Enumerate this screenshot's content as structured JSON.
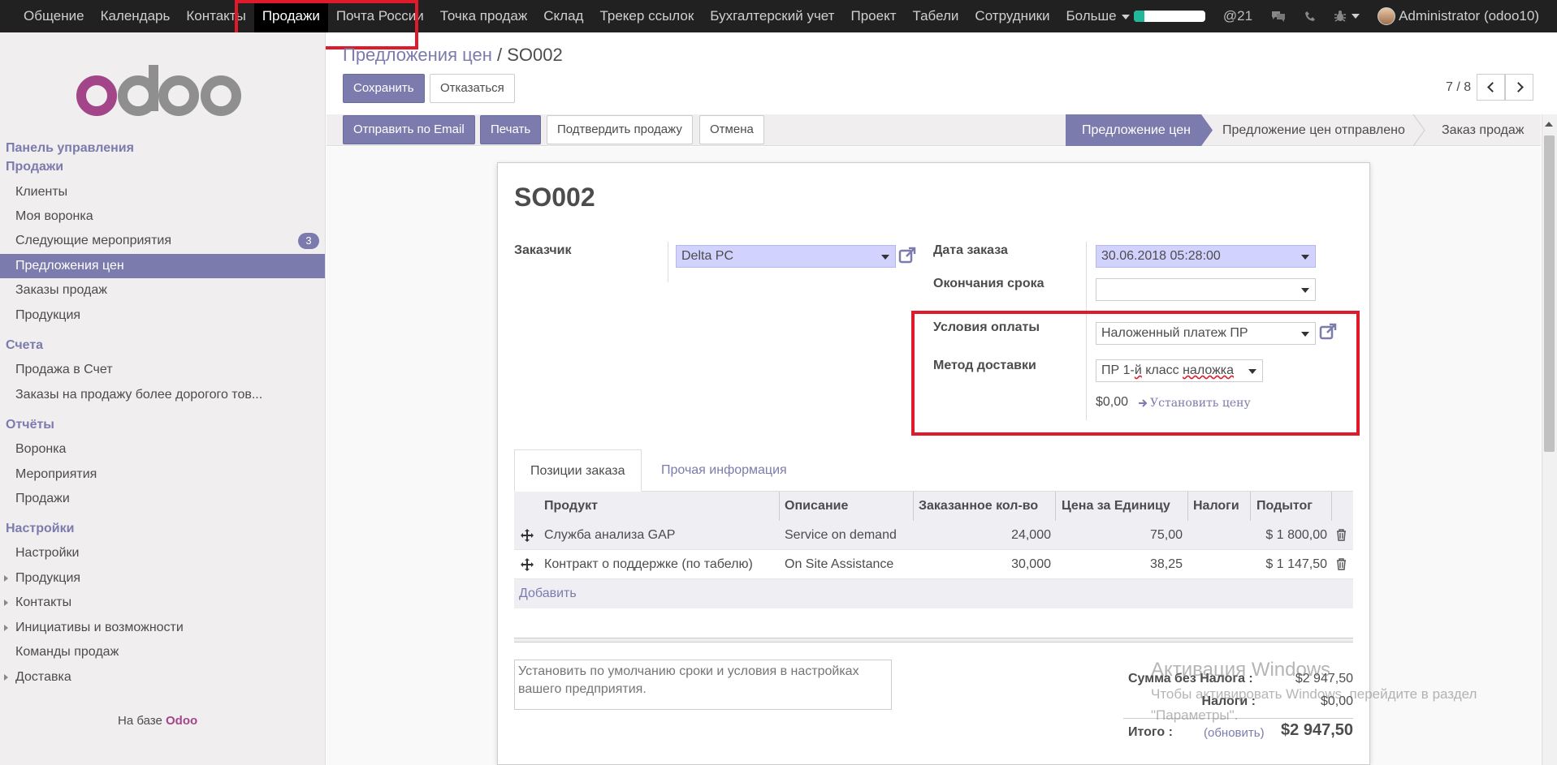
{
  "topnav": {
    "items": [
      "Общение",
      "Календарь",
      "Контакты",
      "Продажи",
      "Почта России",
      "Точка продаж",
      "Склад",
      "Трекер ссылок",
      "Бухгалтерский учет",
      "Проект",
      "Табели",
      "Сотрудники",
      "Больше"
    ],
    "active": "Продажи",
    "mentions_count": "@21",
    "user": "Administrator (odoo10)",
    "progress_fraction": 0.15,
    "progress_color": "#21b799"
  },
  "sidebar": {
    "logo": "odoo",
    "sections": [
      {
        "title": "Панель управления"
      },
      {
        "title": "Продажи",
        "items": [
          {
            "label": "Клиенты"
          },
          {
            "label": "Моя воронка"
          },
          {
            "label": "Следующие мероприятия",
            "badge": "3"
          },
          {
            "label": "Предложения цен",
            "active": true
          },
          {
            "label": "Заказы продаж"
          },
          {
            "label": "Продукция"
          }
        ]
      },
      {
        "title": "Счета",
        "items": [
          {
            "label": "Продажа в Счет"
          },
          {
            "label": "Заказы на продажу более дорогого тов..."
          }
        ]
      },
      {
        "title": "Отчёты",
        "items": [
          {
            "label": "Воронка"
          },
          {
            "label": "Мероприятия"
          },
          {
            "label": "Продажи"
          }
        ]
      },
      {
        "title": "Настройки",
        "items": [
          {
            "label": "Настройки"
          },
          {
            "label": "Продукция",
            "expandable": true
          },
          {
            "label": "Контакты",
            "expandable": true
          },
          {
            "label": "Инициативы и возможности",
            "expandable": true
          },
          {
            "label": "Команды продаж"
          },
          {
            "label": "Доставка",
            "expandable": true
          }
        ]
      }
    ],
    "powered_prefix": "На базе",
    "powered_brand": "Odoo"
  },
  "breadcrumb": {
    "parent": "Предложения цен",
    "sep": "/",
    "current": "SO002"
  },
  "toolbar": {
    "save": "Сохранить",
    "discard": "Отказаться"
  },
  "pager": {
    "value": "7 / 8"
  },
  "actions": {
    "email": "Отправить по Email",
    "print": "Печать",
    "confirm": "Подтвердить продажу",
    "cancel": "Отмена"
  },
  "stages": [
    "Предложение цен",
    "Предложение цен отправлено",
    "Заказ продаж"
  ],
  "active_stage": "Предложение цен",
  "form": {
    "title": "SO002",
    "customer_label": "Заказчик",
    "customer_value": "Delta PC",
    "order_date_label": "Дата заказа",
    "order_date_value": "30.06.2018 05:28:00",
    "validity_label": "Окончания срока",
    "validity_value": "",
    "payment_terms_label": "Условия оплаты",
    "payment_terms_value": "Наложенный платеж ПР",
    "delivery_label": "Метод доставки",
    "delivery_value_pre": "ПР 1-",
    "delivery_value_err1": "й",
    "delivery_value_mid": " класс ",
    "delivery_value_err2": "наложка",
    "delivery_price": "$0,00",
    "set_price": "Установить цену"
  },
  "tabs": [
    "Позиции заказа",
    "Прочая информация"
  ],
  "table": {
    "headers": [
      "Продукт",
      "Описание",
      "Заказанное кол-во",
      "Цена за Единицу",
      "Налоги",
      "Подытог"
    ],
    "rows": [
      {
        "product": "Служба анализа GAP",
        "description": "Service on demand",
        "qty": "24,000",
        "price": "75,00",
        "taxes": "",
        "subtotal": "$ 1 800,00"
      },
      {
        "product": "Контракт о поддержке (по табелю)",
        "description": "On Site Assistance",
        "qty": "30,000",
        "price": "38,25",
        "taxes": "",
        "subtotal": "$ 1 147,50"
      }
    ],
    "add_line": "Добавить"
  },
  "note_placeholder": "Установить по умолчанию сроки и условия в настройках вашего предприятия.",
  "totals": {
    "untaxed_label": "Сумма без Налога :",
    "untaxed_value": "$2 947,50",
    "taxes_label": "Налоги :",
    "taxes_value": "$0,00",
    "total_label": "Итого :",
    "update_label": "(обновить)",
    "total_value": "$2 947,50"
  },
  "watermark": {
    "line1": "Активация Windows",
    "line2": "Чтобы активировать Windows, перейдите в раздел",
    "line3": "\"Параметры\"."
  },
  "colors": {
    "accent": "#7c7bad",
    "topbar": "#212121",
    "highlight_box": "#e01a2b",
    "brand": "#a24689"
  }
}
